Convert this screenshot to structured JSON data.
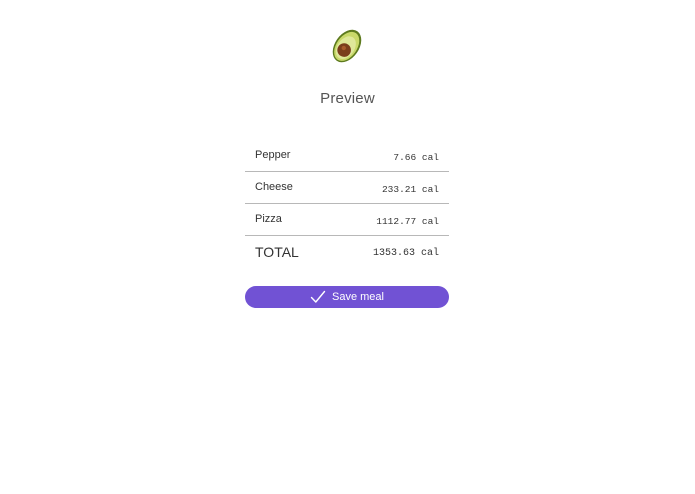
{
  "header": {
    "logo_icon": "avocado-icon",
    "title": "Preview"
  },
  "meal": {
    "items": [
      {
        "name": "Pepper",
        "calories": "7.66 cal"
      },
      {
        "name": "Cheese",
        "calories": "233.21 cal"
      },
      {
        "name": "Pizza",
        "calories": "1112.77 cal"
      }
    ],
    "total": {
      "label": "TOTAL",
      "calories": "1353.63 cal"
    }
  },
  "actions": {
    "save_label": "Save meal",
    "save_icon": "checkmark-icon",
    "accent_color": "#7152d4"
  }
}
